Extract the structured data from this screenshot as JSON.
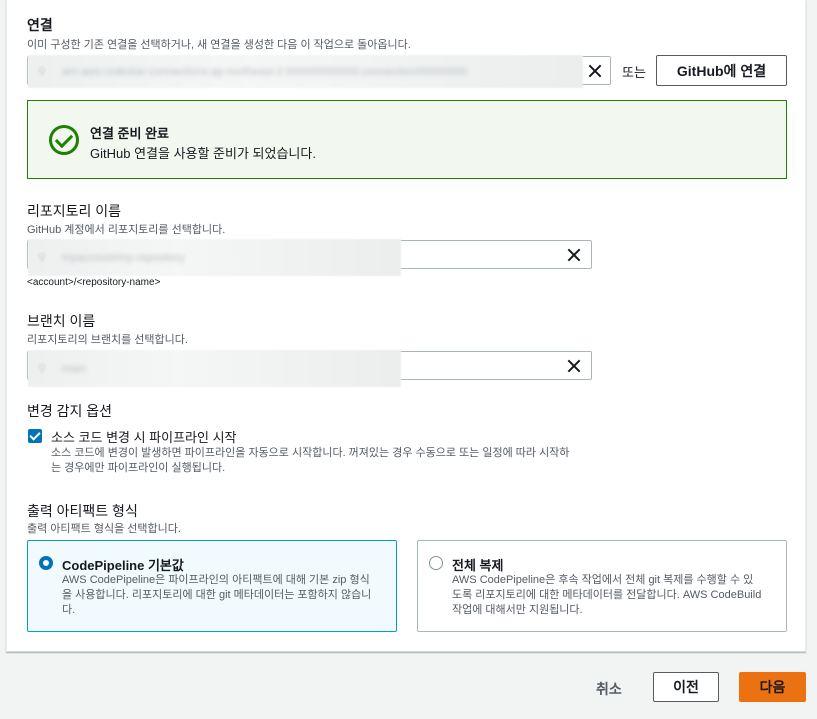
{
  "connection": {
    "label": "연결",
    "description": "이미 구성한 기존 연결을 선택하거나, 새 연결을 생성한 다음 이 작업으로 돌아옵니다.",
    "or_text": "또는",
    "connect_button": "GitHub에 연결"
  },
  "alert": {
    "title": "연결 준비 완료",
    "message": "GitHub 연결을 사용할 준비가 되었습니다."
  },
  "repository": {
    "label": "리포지토리 이름",
    "description": "GitHub 계정에서 리포지토리를 선택합니다.",
    "hint": "<account>/<repository-name>"
  },
  "branch": {
    "label": "브랜치 이름",
    "description": "리포지토리의 브랜치를 선택합니다."
  },
  "change_detection": {
    "label": "변경 감지 옵션",
    "checkbox_label": "소스 코드 변경 시 파이프라인 시작",
    "checkbox_desc_line1": "소스 코드에 변경이 발생하면 파이프라인을 자동으로 시작합니다. 꺼져있는 경우 수동으로 또는 일정에 따라 시작하",
    "checkbox_desc_line2": "는 경우에만 파이프라인이 실행됩니다.",
    "checked": true
  },
  "artifact": {
    "label": "출력 아티팩트 형식",
    "description": "출력 아티팩트 형식을 선택합니다.",
    "options": [
      {
        "title": "CodePipeline 기본값",
        "desc_line1": "AWS CodePipeline은 파이프라인의 아티팩트에 대해 기본 zip 형식",
        "desc_line2": "을 사용합니다. 리포지토리에 대한 git 메타데이터는 포함하지 않습니",
        "desc_line3": "다.",
        "selected": true
      },
      {
        "title": "전체 복제",
        "desc_line1": "AWS CodePipeline은 후속 작업에서 전체 git 복제를 수행할 수 있",
        "desc_line2": "도록 리포지토리에 대한 메타데이터를 전달합니다. AWS CodeBuild",
        "desc_line3": "작업에 대해서만 지원됩니다.",
        "selected": false
      }
    ]
  },
  "footer": {
    "cancel": "취소",
    "previous": "이전",
    "next": "다음"
  },
  "colors": {
    "primary": "#ec7211",
    "success": "#1d8102",
    "selected_border": "#00a1c9",
    "checkbox": "#0073bb"
  }
}
